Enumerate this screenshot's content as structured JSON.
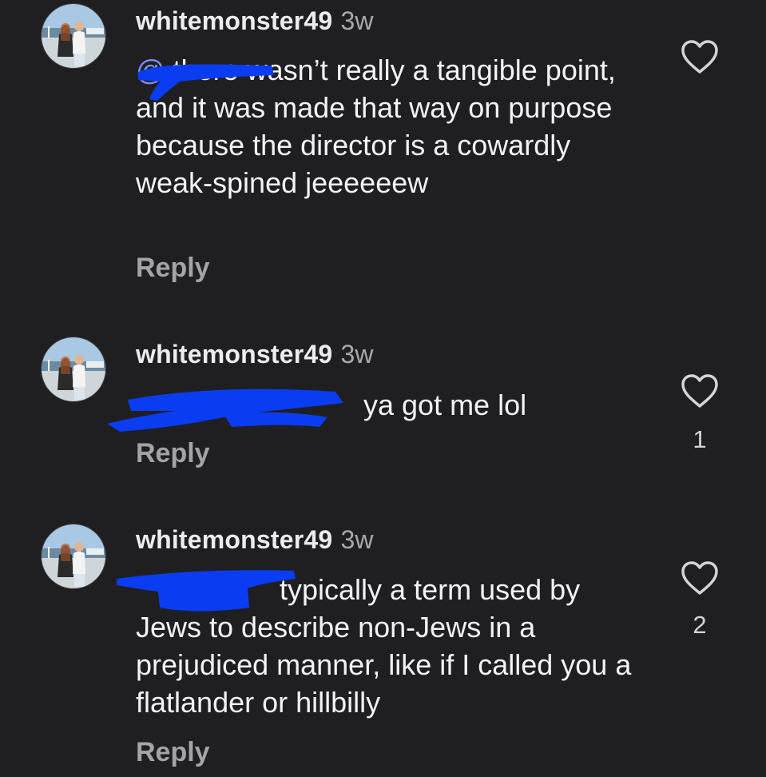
{
  "colors": {
    "background": "#1f1f22",
    "username": "#ececef",
    "timestamp": "#a9a9ad",
    "text": "#f3f3f5",
    "mention": "#7e8ef0",
    "reply": "#a3a3a8",
    "redaction": "#0a3df2"
  },
  "icons": {
    "like": "heart-outline-icon"
  },
  "comments": [
    {
      "username": "whitemonster49",
      "timestamp": "3w",
      "mention": "@",
      "text": " there wasn’t really a tangible point, and it was made that way on purpose because the director is a cowardly weak-spined jeeeeeew",
      "reply_label": "Reply",
      "like_count": ""
    },
    {
      "username": "whitemonster49",
      "timestamp": "3w",
      "mention": "",
      "text": " ya got me lol",
      "reply_label": "Reply",
      "like_count": "1"
    },
    {
      "username": "whitemonster49",
      "timestamp": "3w",
      "mention": "",
      "text": " typically a term used by Jews to describe non-Jews in a prejudiced manner, like if I called you a flatlander or hillbilly",
      "reply_label": "Reply",
      "like_count": "2"
    }
  ]
}
